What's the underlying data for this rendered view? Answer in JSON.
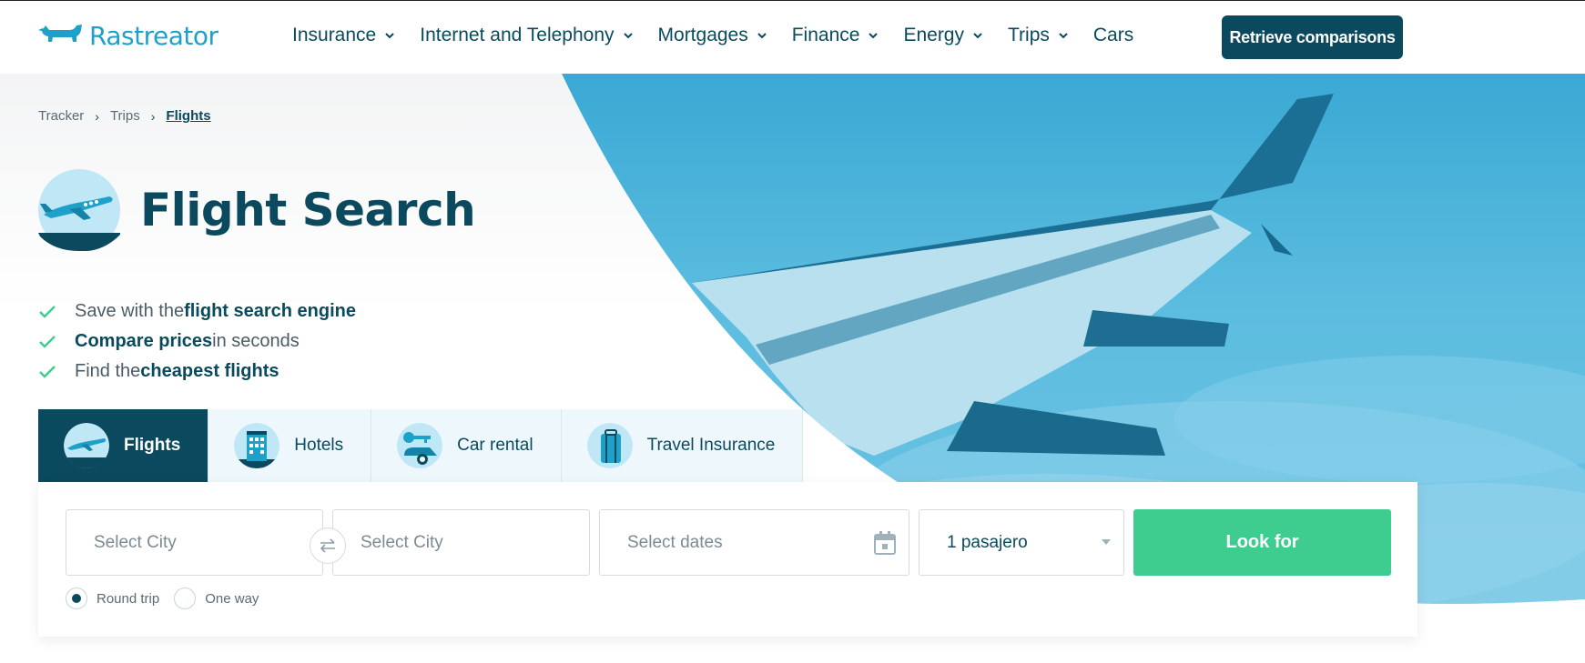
{
  "header": {
    "logo_text": "Rastreator",
    "nav": [
      {
        "label": "Insurance",
        "has_dropdown": true
      },
      {
        "label": "Internet and Telephony",
        "has_dropdown": true
      },
      {
        "label": "Mortgages",
        "has_dropdown": true
      },
      {
        "label": "Finance",
        "has_dropdown": true
      },
      {
        "label": "Energy",
        "has_dropdown": true
      },
      {
        "label": "Trips",
        "has_dropdown": true
      },
      {
        "label": "Cars",
        "has_dropdown": false
      }
    ],
    "retrieve_label": "Retrieve comparisons"
  },
  "breadcrumb": {
    "items": [
      "Tracker",
      "Trips"
    ],
    "current": "Flights",
    "separator": "›"
  },
  "page": {
    "title": "Flight Search"
  },
  "benefits": [
    {
      "pre": "Save with the ",
      "bold": "flight search engine",
      "post": ""
    },
    {
      "pre": "",
      "bold": "Compare prices",
      "post": " in seconds"
    },
    {
      "pre": "Find the ",
      "bold": "cheapest flights",
      "post": ""
    }
  ],
  "tabs": [
    {
      "label": "Flights",
      "icon": "airplane-icon",
      "active": true
    },
    {
      "label": "Hotels",
      "icon": "hotel-icon",
      "active": false
    },
    {
      "label": "Car rental",
      "icon": "car-key-icon",
      "active": false
    },
    {
      "label": "Travel Insurance",
      "icon": "suitcase-icon",
      "active": false
    }
  ],
  "search": {
    "origin_placeholder": "Select City",
    "destination_placeholder": "Select City",
    "dates_placeholder": "Select dates",
    "passengers_value": "1 pasajero",
    "submit_label": "Look for",
    "trip_types": [
      {
        "label": "Round trip",
        "selected": true
      },
      {
        "label": "One way",
        "selected": false
      }
    ]
  },
  "colors": {
    "brand_dark": "#0b4a5e",
    "brand_light": "#1ea1c8",
    "accent_green": "#3fcd8f",
    "check_green": "#3fcd8f"
  }
}
